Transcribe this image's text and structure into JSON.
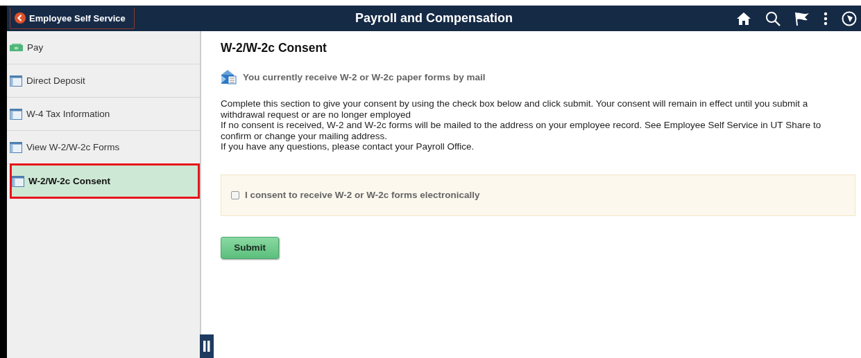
{
  "header": {
    "back_label": "Employee Self Service",
    "title": "Payroll and Compensation"
  },
  "sidebar": {
    "items": [
      {
        "label": "Pay",
        "kind": "money",
        "selected": false
      },
      {
        "label": "Direct Deposit",
        "kind": "page",
        "selected": false
      },
      {
        "label": "W-4 Tax Information",
        "kind": "page",
        "selected": false
      },
      {
        "label": "View W-2/W-2c Forms",
        "kind": "page",
        "selected": false
      },
      {
        "label": "W-2/W-2c Consent",
        "kind": "page",
        "selected": true
      }
    ]
  },
  "content": {
    "title": "W-2/W-2c Consent",
    "notice": "You currently receive W-2 or W-2c paper forms by mail",
    "paragraphs": [
      "Complete this section to give your consent by using the check box below and click submit.  Your consent will remain in effect until you submit a withdrawal request or are no longer employed",
      "If no consent is received, W-2 and W-2c forms will be mailed to the address on your employee record. See Employee Self Service in UT Share to confirm or change your mailing address.",
      "If you have any questions, please contact your Payroll Office."
    ],
    "consent": {
      "label": "I consent to receive W-2 or W-2c forms electronically",
      "checked": false
    },
    "submit": "Submit"
  }
}
